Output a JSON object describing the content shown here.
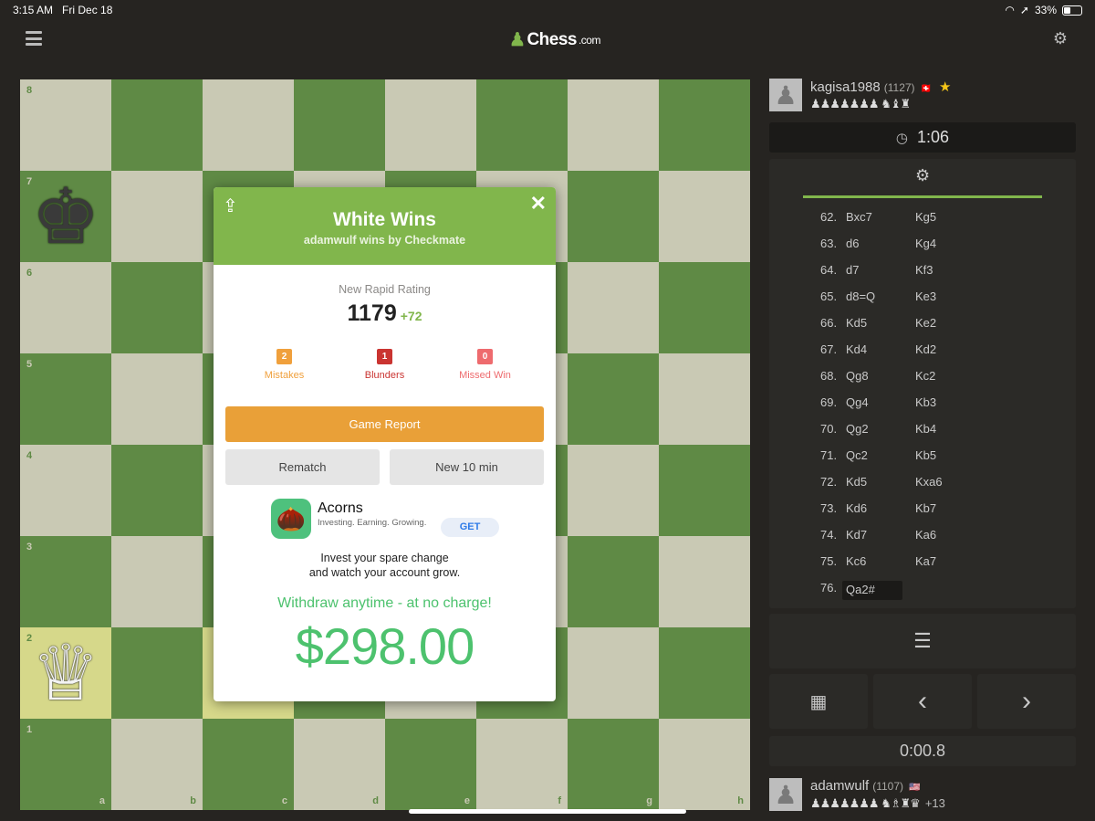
{
  "status_bar": {
    "time": "3:15 AM",
    "date": "Fri Dec 18",
    "battery": "33%"
  },
  "header": {
    "logo_text": "Chess",
    "logo_suffix": ".com"
  },
  "board": {
    "ranks": [
      "8",
      "7",
      "6",
      "5",
      "4",
      "3",
      "2",
      "1"
    ],
    "files": [
      "a",
      "b",
      "c",
      "d",
      "e",
      "f",
      "g",
      "h"
    ],
    "pieces": {
      "black_king": "♚",
      "white_queen": "♕"
    }
  },
  "modal": {
    "title": "White Wins",
    "subtitle": "adamwulf wins by Checkmate",
    "rating_label": "New Rapid Rating",
    "rating": "1179",
    "rating_delta": "+72",
    "counts": [
      {
        "value": "2",
        "label": "Mistakes"
      },
      {
        "value": "1",
        "label": "Blunders"
      },
      {
        "value": "0",
        "label": "Missed Win"
      }
    ],
    "game_report": "Game Report",
    "rematch": "Rematch",
    "new_game": "New 10 min",
    "ad": {
      "name": "Acorns",
      "tagline": "Investing. Earning. Growing.",
      "get": "GET",
      "line1": "Invest your spare change",
      "line2": "and watch your account grow.",
      "withdraw": "Withdraw anytime - at no charge!",
      "amount": "$298.00"
    }
  },
  "top_player": {
    "name": "kagisa1988",
    "rating": "(1127)",
    "flag": "🇨🇭",
    "captured": "♟♟♟♟♟♟♟ ♞♝♜"
  },
  "top_clock": "1:06",
  "moves": [
    {
      "n": "62.",
      "w": "Bxc7",
      "b": "Kg5"
    },
    {
      "n": "63.",
      "w": "d6",
      "b": "Kg4"
    },
    {
      "n": "64.",
      "w": "d7",
      "b": "Kf3"
    },
    {
      "n": "65.",
      "w": "d8=Q",
      "b": "Ke3"
    },
    {
      "n": "66.",
      "w": "Kd5",
      "b": "Ke2"
    },
    {
      "n": "67.",
      "w": "Kd4",
      "b": "Kd2"
    },
    {
      "n": "68.",
      "w": "Qg8",
      "b": "Kc2"
    },
    {
      "n": "69.",
      "w": "Qg4",
      "b": "Kb3"
    },
    {
      "n": "70.",
      "w": "Qg2",
      "b": "Kb4"
    },
    {
      "n": "71.",
      "w": "Qc2",
      "b": "Kb5"
    },
    {
      "n": "72.",
      "w": "Kd5",
      "b": "Kxa6"
    },
    {
      "n": "73.",
      "w": "Kd6",
      "b": "Kb7"
    },
    {
      "n": "74.",
      "w": "Kd7",
      "b": "Ka6"
    },
    {
      "n": "75.",
      "w": "Kc6",
      "b": "Ka7"
    },
    {
      "n": "76.",
      "w": "Qa2#",
      "b": ""
    }
  ],
  "bottom_clock": "0:00.8",
  "bottom_player": {
    "name": "adamwulf",
    "rating": "(1107)",
    "flag": "🇺🇸",
    "captured": "♟♟♟♟♟♟♟ ♞♗♜♛",
    "advantage": "+13"
  },
  "colors": {
    "accent": "#81b64c",
    "report": "#e9a038",
    "dark_square": "#5f8a45",
    "light_square": "#c9c9b4"
  }
}
